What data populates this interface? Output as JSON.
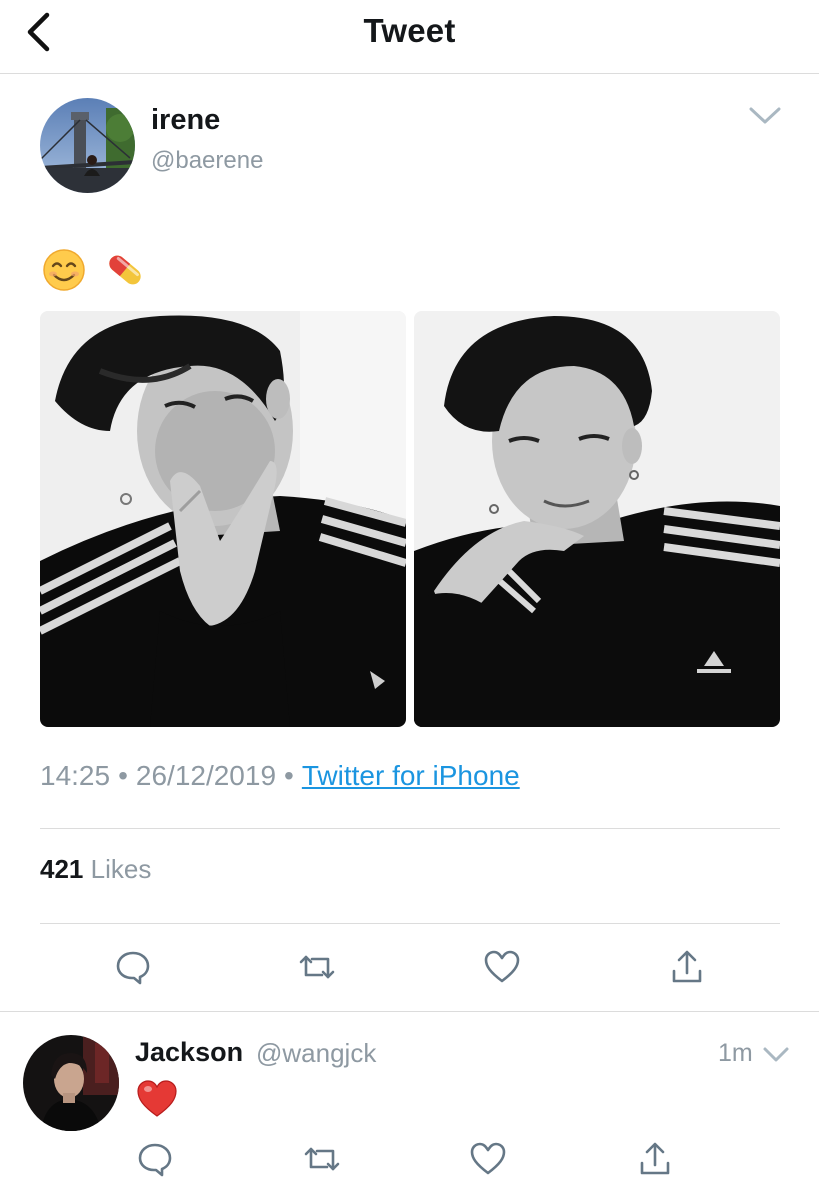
{
  "header": {
    "title": "Tweet",
    "back_icon": "chevron-left-icon"
  },
  "tweet": {
    "author_name": "irene",
    "author_handle": "@baerene",
    "avatar_icon": "bridge-photo-avatar",
    "caret_icon": "chevron-down-icon",
    "text_emojis": [
      "smiling-face-emoji",
      "pill-emoji"
    ],
    "photos": [
      "black-and-white portrait, hand on cheek",
      "black-and-white portrait, chin on hand"
    ],
    "time": "14:25",
    "date": "26/12/2019",
    "separator": "•",
    "source": "Twitter for iPhone",
    "likes_count": "421",
    "likes_label": "Likes",
    "actions": [
      "reply-icon",
      "retweet-icon",
      "like-icon",
      "share-icon"
    ],
    "colors": {
      "link": "#1b95e0",
      "muted": "#8e99a2",
      "text": "#14171a",
      "divider": "#dcdcdc"
    }
  },
  "reply": {
    "author_name": "Jackson",
    "author_handle": "@wangjck",
    "time": "1m",
    "text_emoji": "red-heart-emoji",
    "caret_icon": "chevron-down-icon",
    "actions": [
      "reply-icon",
      "retweet-icon",
      "like-icon",
      "share-icon"
    ]
  }
}
